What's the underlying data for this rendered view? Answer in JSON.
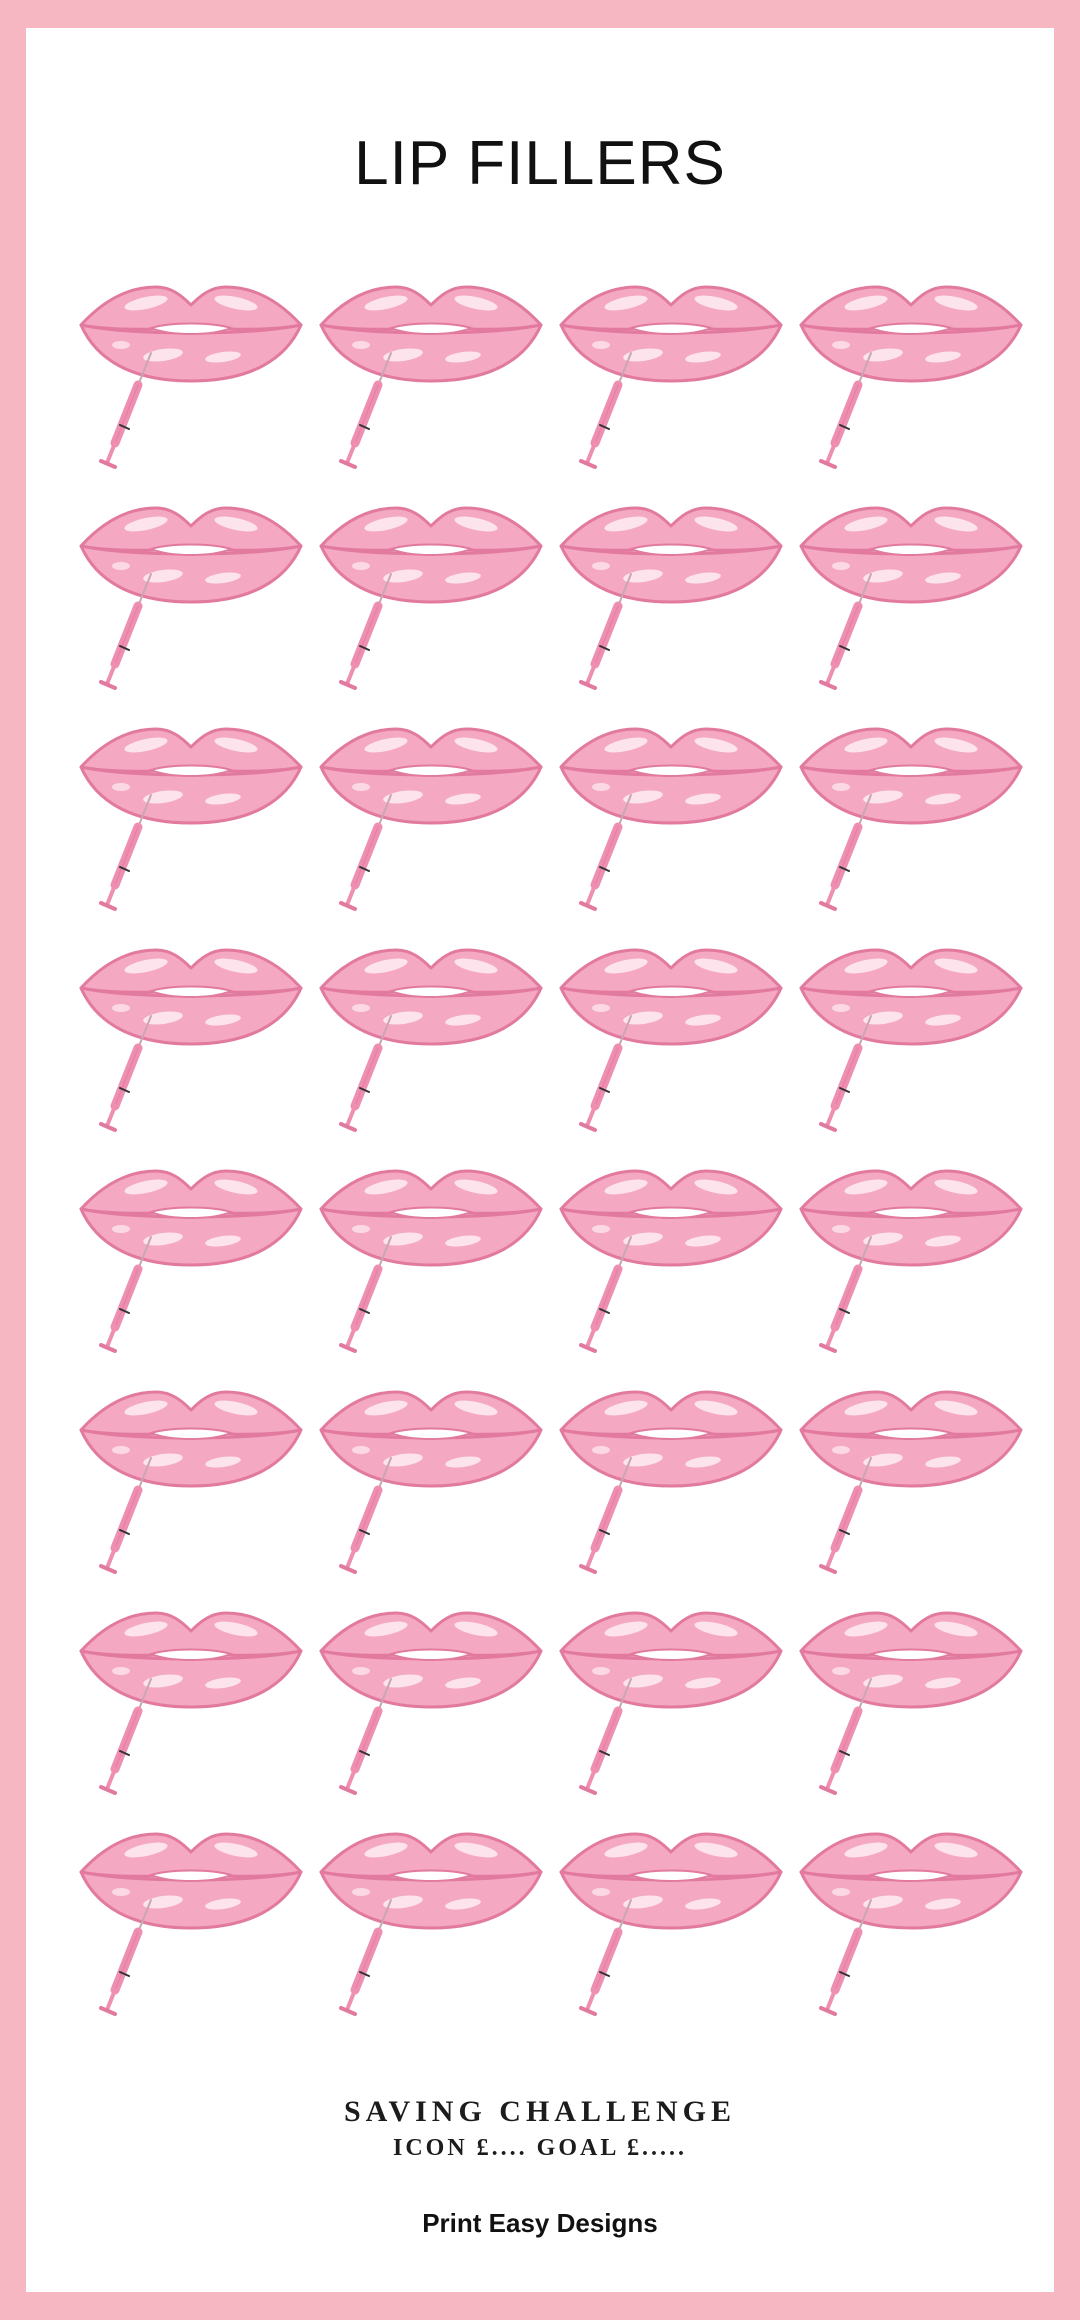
{
  "title": "LIP FILLERS",
  "grid": {
    "rows": 8,
    "columns": 4,
    "icon": "lips-syringe-icon"
  },
  "footer": {
    "heading": "SAVING CHALLENGE",
    "sub": "ICON £.... GOAL £.....",
    "brand": "Print Easy Designs"
  },
  "colors": {
    "border": "#f6b7c2",
    "lip": "#f4a8c2",
    "lip_outline": "#e27aa0",
    "highlight": "#fde3ec",
    "syringe": "#ee8fb2"
  }
}
